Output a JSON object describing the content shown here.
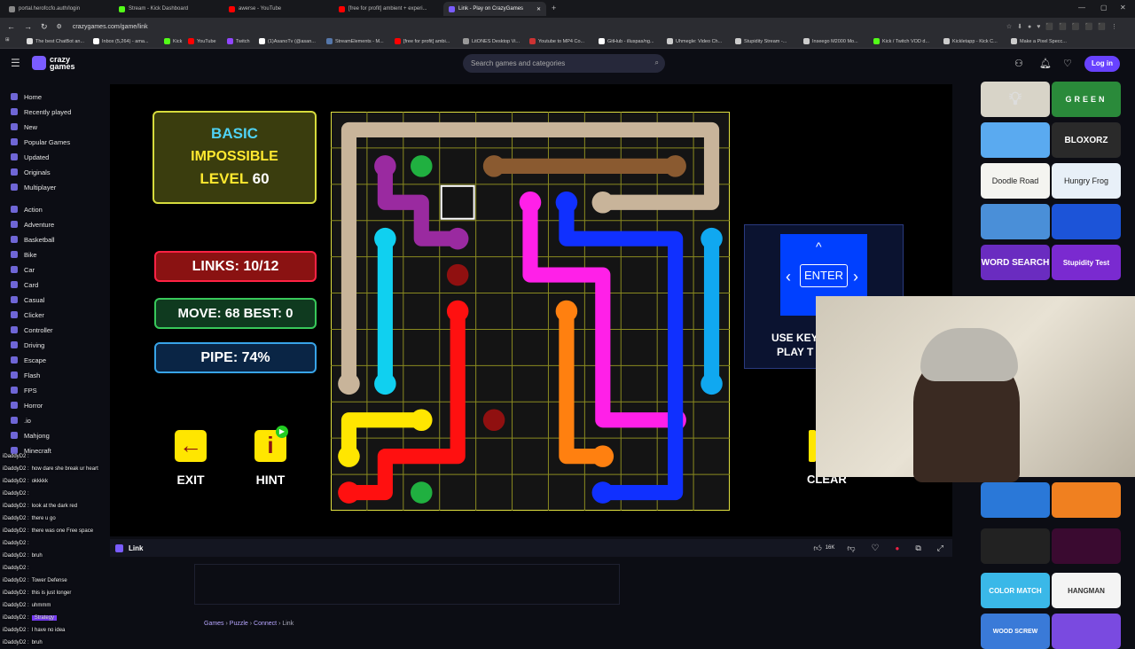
{
  "browser": {
    "tabs": [
      "portal.herofccfo.auth/login",
      "Stream - Kick Dashboard",
      "awerse - YouTube",
      "[free for profit] ambient + experi...",
      "Link - Play on CrazyGames"
    ],
    "url": "crazygames.com/game/link",
    "bookmarks": [
      "The best ChatBot an...",
      "Inbox (5,264) - ama...",
      "Kick",
      "YouTube",
      "Twitch",
      "(1)AsanoTv (@asan...",
      "StreamElements - M...",
      "[free for profit] ambi...",
      "LitONES Desktop Vi...",
      "Youtube to MP4 Co...",
      "GitHub - illuspas/ng...",
      "Uhmegle: Video Ch...",
      "Stupidity Stream -...",
      "Inseego M2000 Mo...",
      "Kick / Twitch VOD d...",
      "Kickletapp - Kick C...",
      "Make a Pixel Specc..."
    ]
  },
  "site": {
    "logo": "crazy games",
    "search_placeholder": "Search games and categories",
    "login": "Log in"
  },
  "sidebar": [
    "Home",
    "Recently played",
    "New",
    "Popular Games",
    "Updated",
    "Originals",
    "Multiplayer",
    "Action",
    "Adventure",
    "Basketball",
    "Bike",
    "Car",
    "Card",
    "Casual",
    "Clicker",
    "Controller",
    "Driving",
    "Escape",
    "Flash",
    "FPS",
    "Horror",
    ".io",
    "Mahjong",
    "Minecraft"
  ],
  "game": {
    "mode1": "BASIC",
    "mode2": "IMPOSSIBLE",
    "level_label": "LEVEL",
    "level": "60",
    "links": "LINKS:  10/12",
    "move": "MOVE: 68   BEST: 0",
    "pipe": "PIPE: 74%",
    "exit": "EXIT",
    "hint": "HINT",
    "enter": "ENTER",
    "use_keys": "USE KEY",
    "play_t": "PLAY T",
    "clear": "CLEAR",
    "grid_progress": 0.74
  },
  "game_bar": {
    "title": "Link",
    "likes": "16K"
  },
  "breadcrumb": [
    "Games",
    "Puzzle",
    "Connect",
    "Link"
  ],
  "thumbs": [
    "GREEN",
    "BLOXORZ",
    "Doodle Road",
    "Hungry Frog",
    "WORD SEARCH",
    "Stupidity Test",
    "COLOR MATCH",
    "HANGMAN",
    "WOOD SCREW"
  ],
  "chat": [
    {
      "user": "iDaddyD2 :",
      "msg": ""
    },
    {
      "user": "iDaddyD2 :",
      "msg": "how dare she break ur heart"
    },
    {
      "user": "iDaddyD2 :",
      "msg": "okkkkk"
    },
    {
      "user": "iDaddyD2 :",
      "msg": ""
    },
    {
      "user": "iDaddyD2 :",
      "msg": "look at the dark red"
    },
    {
      "user": "iDaddyD2 :",
      "msg": "there u go"
    },
    {
      "user": "iDaddyD2 :",
      "msg": "there was one Free space"
    },
    {
      "user": "iDaddyD2 :",
      "msg": ""
    },
    {
      "user": "iDaddyD2 :",
      "msg": "bruh"
    },
    {
      "user": "iDaddyD2 :",
      "msg": ""
    },
    {
      "user": "iDaddyD2 :",
      "msg": "Tower Defense"
    },
    {
      "user": "iDaddyD2 :",
      "msg": "this is just longer"
    },
    {
      "user": "iDaddyD2 :",
      "msg": "uhmmm"
    },
    {
      "user": "iDaddyD2 :",
      "msg": "Strategy"
    },
    {
      "user": "iDaddyD2 :",
      "msg": "I have no idea"
    },
    {
      "user": "iDaddyD2 :",
      "msg": "bruh"
    }
  ]
}
